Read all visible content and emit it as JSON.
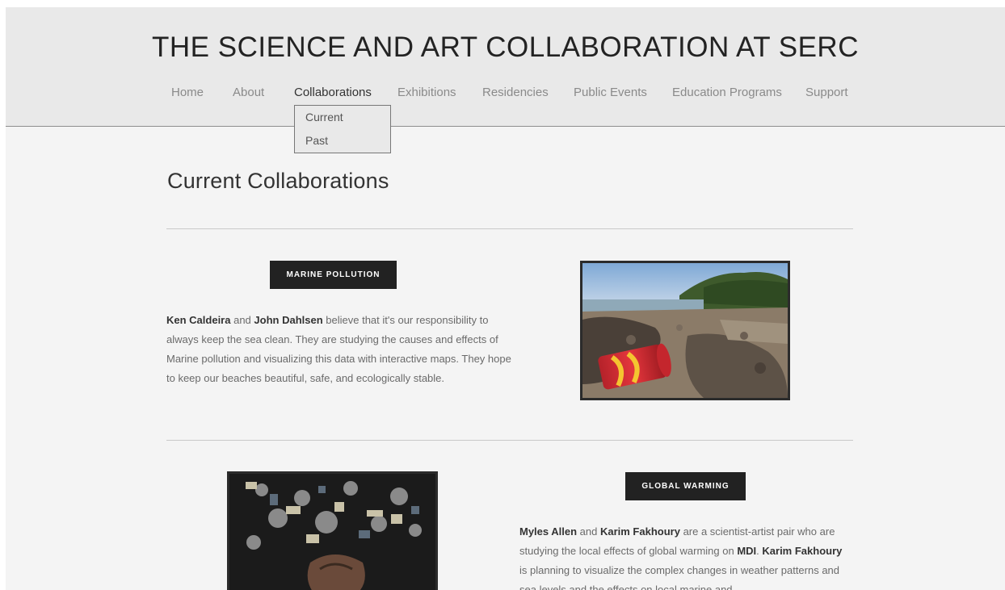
{
  "site": {
    "title": "THE SCIENCE AND ART COLLABORATION AT SERC"
  },
  "nav": {
    "items": [
      {
        "label": "Home"
      },
      {
        "label": "About"
      },
      {
        "label": "Collaborations"
      },
      {
        "label": "Exhibitions"
      },
      {
        "label": "Residencies"
      },
      {
        "label": "Public Events"
      },
      {
        "label": "Education Programs"
      },
      {
        "label": "Support"
      }
    ],
    "active": "Collaborations",
    "dropdown": [
      {
        "label": "Current"
      },
      {
        "label": "Past"
      }
    ]
  },
  "page": {
    "heading": "Current Collaborations"
  },
  "collaborations": [
    {
      "tag": "MARINE POLLUTION",
      "person1": "Ken Caldeira",
      "joiner1": " and ",
      "person2": "John Dahlsen",
      "text1": " believe that it's our responsibility to always keep the sea clean. They are studying the causes and effects of Marine pollution and visualizing this data with interactive maps. They hope to keep our beaches beautiful, safe, and ecologically stable.",
      "image_icon": "beach-barrel-photo"
    },
    {
      "tag": "GLOBAL WARMING",
      "person1": "Myles Allen",
      "joiner1": " and ",
      "person2": "Karim Fakhoury",
      "text1": " are a scientist-artist pair who are studying the local effects of global warming on ",
      "place": "MDI",
      "text2": ". ",
      "person3": "Karim Fakhoury",
      "text3": "  is planning to visualize the complex changes in weather patterns and sea levels and the effects on local marine and",
      "image_icon": "debris-collage-photo"
    }
  ],
  "colors": {
    "header_bg": "#e9e9e9",
    "page_bg": "#f4f4f4",
    "button_bg": "#222222",
    "text_dark": "#333333",
    "text_muted": "#6a6a6a"
  }
}
